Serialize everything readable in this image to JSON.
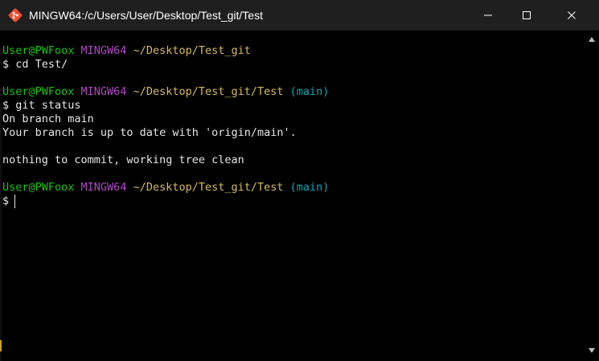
{
  "window": {
    "title": "MINGW64:/c/Users/User/Desktop/Test_git/Test",
    "icon": "git-icon",
    "controls": [
      "minimize-icon",
      "maximize-icon",
      "close-icon"
    ],
    "colors": {
      "titlebar": "#1f1f1f",
      "background": "#000000"
    }
  },
  "terminal": {
    "colors": {
      "text": "#e6e6e6",
      "user_host": "#16c60c",
      "mingw": "#b148c6",
      "path": "#d7ba5a",
      "branch": "#0aa7b6"
    },
    "prompt1": {
      "user_host": "User@PWFoox",
      "mingw": "MINGW64",
      "path": "~/Desktop/Test_git"
    },
    "cmd1": "$ cd Test/",
    "prompt2": {
      "user_host": "User@PWFoox",
      "mingw": "MINGW64",
      "path": "~/Desktop/Test_git/Test",
      "branch": "(main)"
    },
    "cmd2": "$ git status",
    "out1": "On branch main",
    "out2": "Your branch is up to date with 'origin/main'.",
    "out3": "nothing to commit, working tree clean",
    "prompt3": {
      "user_host": "User@PWFoox",
      "mingw": "MINGW64",
      "path": "~/Desktop/Test_git/Test",
      "branch": "(main)"
    },
    "cmd3": "$"
  }
}
